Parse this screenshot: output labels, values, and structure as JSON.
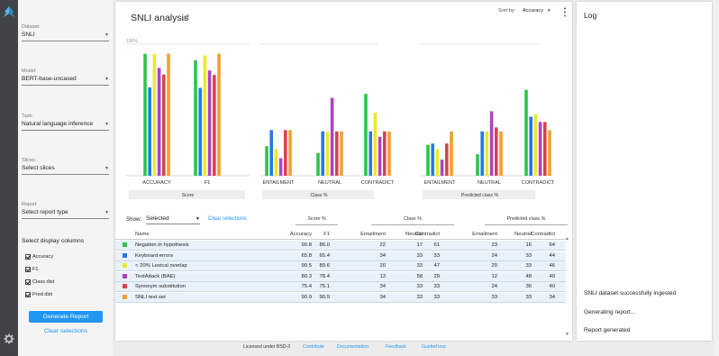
{
  "sidebar": {
    "dataset_label": "Dataset:",
    "dataset_value": "SNLI",
    "model_label": "Model:",
    "model_value": "BERT-base-uncased",
    "task_label": "Task:",
    "task_value": "Natural language inference",
    "slices_label": "Slices:",
    "slices_value": "Select slices",
    "report_label": "Report",
    "report_value": "Select report type",
    "columns_title": "Select display columns",
    "columns": [
      "Accuracy",
      "F1",
      "Class dist",
      "Pred dist"
    ],
    "generate_label": "Generate Report",
    "clear_label": "Clear selections"
  },
  "main": {
    "title": "SNLI analysis",
    "sort_label": "Sort by:",
    "sort_value": "Accuracy",
    "show_label": "Show:",
    "show_value": "Selected",
    "clear_selections": "Clear selections",
    "group_score": "Score %",
    "group_class": "Class %",
    "group_pred": "Predicted class %"
  },
  "chart_data": {
    "type": "bar",
    "ylim": [
      0,
      100
    ],
    "top_tick": "100%",
    "panels": [
      {
        "footer": "Score",
        "categories": [
          "ACCURACY",
          "F1"
        ],
        "metric_keys": [
          "accuracy",
          "f1"
        ]
      },
      {
        "footer": "Class %",
        "categories": [
          "ENTAILMENT",
          "NEUTRAL",
          "CONTRADICT"
        ],
        "metric_keys": [
          "class_ent",
          "class_neu",
          "class_con"
        ]
      },
      {
        "footer": "Predicted class %",
        "categories": [
          "ENTAILMENT",
          "NEUTRAL",
          "CONTRADICT"
        ],
        "metric_keys": [
          "pred_ent",
          "pred_neu",
          "pred_con"
        ]
      }
    ],
    "series": [
      {
        "color": "#2ec44a",
        "accuracy": 90.8,
        "f1": 86.0,
        "class_ent": 22,
        "class_neu": 17,
        "class_con": 61,
        "pred_ent": 23,
        "pred_neu": 16,
        "pred_con": 64
      },
      {
        "color": "#2979e6",
        "accuracy": 65.8,
        "f1": 65.4,
        "class_ent": 34,
        "class_neu": 33,
        "class_con": 33,
        "pred_ent": 24,
        "pred_neu": 33,
        "pred_con": 44
      },
      {
        "color": "#eaea2b",
        "accuracy": 90.5,
        "f1": 89.6,
        "class_ent": 20,
        "class_neu": 33,
        "class_con": 47,
        "pred_ent": 20,
        "pred_neu": 33,
        "pred_con": 46
      },
      {
        "color": "#b042c4",
        "accuracy": 80.3,
        "f1": 78.4,
        "class_ent": 13,
        "class_neu": 58,
        "class_con": 29,
        "pred_ent": 12,
        "pred_neu": 48,
        "pred_con": 40
      },
      {
        "color": "#d8434a",
        "accuracy": 75.4,
        "f1": 75.1,
        "class_ent": 34,
        "class_neu": 33,
        "class_con": 33,
        "pred_ent": 24,
        "pred_neu": 36,
        "pred_con": 40
      },
      {
        "color": "#f0a033",
        "accuracy": 90.9,
        "f1": 90.9,
        "class_ent": 34,
        "class_neu": 33,
        "class_con": 33,
        "pred_ent": 33,
        "pred_neu": 33,
        "pred_con": 34
      }
    ]
  },
  "table": {
    "headers": [
      "Name",
      "Accuracy",
      "F1",
      "Entailment",
      "Neutral",
      "Contradict",
      "Entailment",
      "Neutral",
      "Contradict"
    ],
    "rows": [
      {
        "color": "#2ec44a",
        "cells": [
          "Negation in hypothesis",
          "90.8",
          "86.0",
          "22",
          "17",
          "61",
          "23",
          "16",
          "64"
        ]
      },
      {
        "color": "#2979e6",
        "cells": [
          "Keyboard errors",
          "65.8",
          "65.4",
          "34",
          "33",
          "33",
          "24",
          "33",
          "44"
        ]
      },
      {
        "color": "#eaea2b",
        "cells": [
          "< 20% Lexical overlap",
          "90.5",
          "89.6",
          "20",
          "33",
          "47",
          "20",
          "33",
          "46"
        ]
      },
      {
        "color": "#b042c4",
        "cells": [
          "TextAttack (BAE)",
          "80.3",
          "78.4",
          "13",
          "58",
          "29",
          "12",
          "48",
          "40"
        ]
      },
      {
        "color": "#d8434a",
        "cells": [
          "Synonym substitution",
          "75.4",
          "75.1",
          "34",
          "33",
          "33",
          "24",
          "36",
          "40"
        ]
      },
      {
        "color": "#f0a033",
        "cells": [
          "SNLI test set",
          "90.9",
          "90.9",
          "34",
          "33",
          "33",
          "33",
          "33",
          "34"
        ]
      }
    ]
  },
  "footer": {
    "license": "Licensed under BSD-3",
    "links": [
      "Contribute",
      "Documentation",
      "Feedback",
      "Guided tour"
    ]
  },
  "log": {
    "title": "Log",
    "entries": [
      "SNLI dataset successfully ingested",
      "Generating report...",
      "Report generated"
    ]
  }
}
